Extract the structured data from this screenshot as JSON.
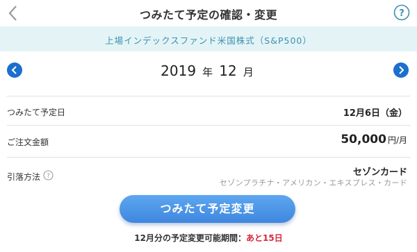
{
  "header": {
    "title": "つみたて予定の確認・変更",
    "back_icon": "chevron-left-icon",
    "help_icon": "question-circle-icon"
  },
  "fund": {
    "name": "上場インデックスファンド米国株式（S&P500）"
  },
  "month": {
    "year": "2019",
    "year_unit": "年",
    "month": "12",
    "month_unit": "月"
  },
  "rows": {
    "date": {
      "label": "つみたて予定日",
      "value": "12月6日（金）"
    },
    "amount": {
      "label": "ご注文金額",
      "value": "50,000",
      "unit": "円/月"
    },
    "payment": {
      "label": "引落方法",
      "card": "セゾンカード",
      "card_detail": "セゾンプラチナ・アメリカン・エキスプレス・カード"
    }
  },
  "button": {
    "label": "つみたて予定変更"
  },
  "deadline": {
    "prefix": "12月分の予定変更可能期間：",
    "remaining": "あと15日"
  },
  "colors": {
    "accent": "#1b6fce",
    "fund_bar_bg": "#e4f4f6",
    "fund_text": "#3d8fb0",
    "button": "#4a90e2",
    "warning": "#d9263a"
  }
}
